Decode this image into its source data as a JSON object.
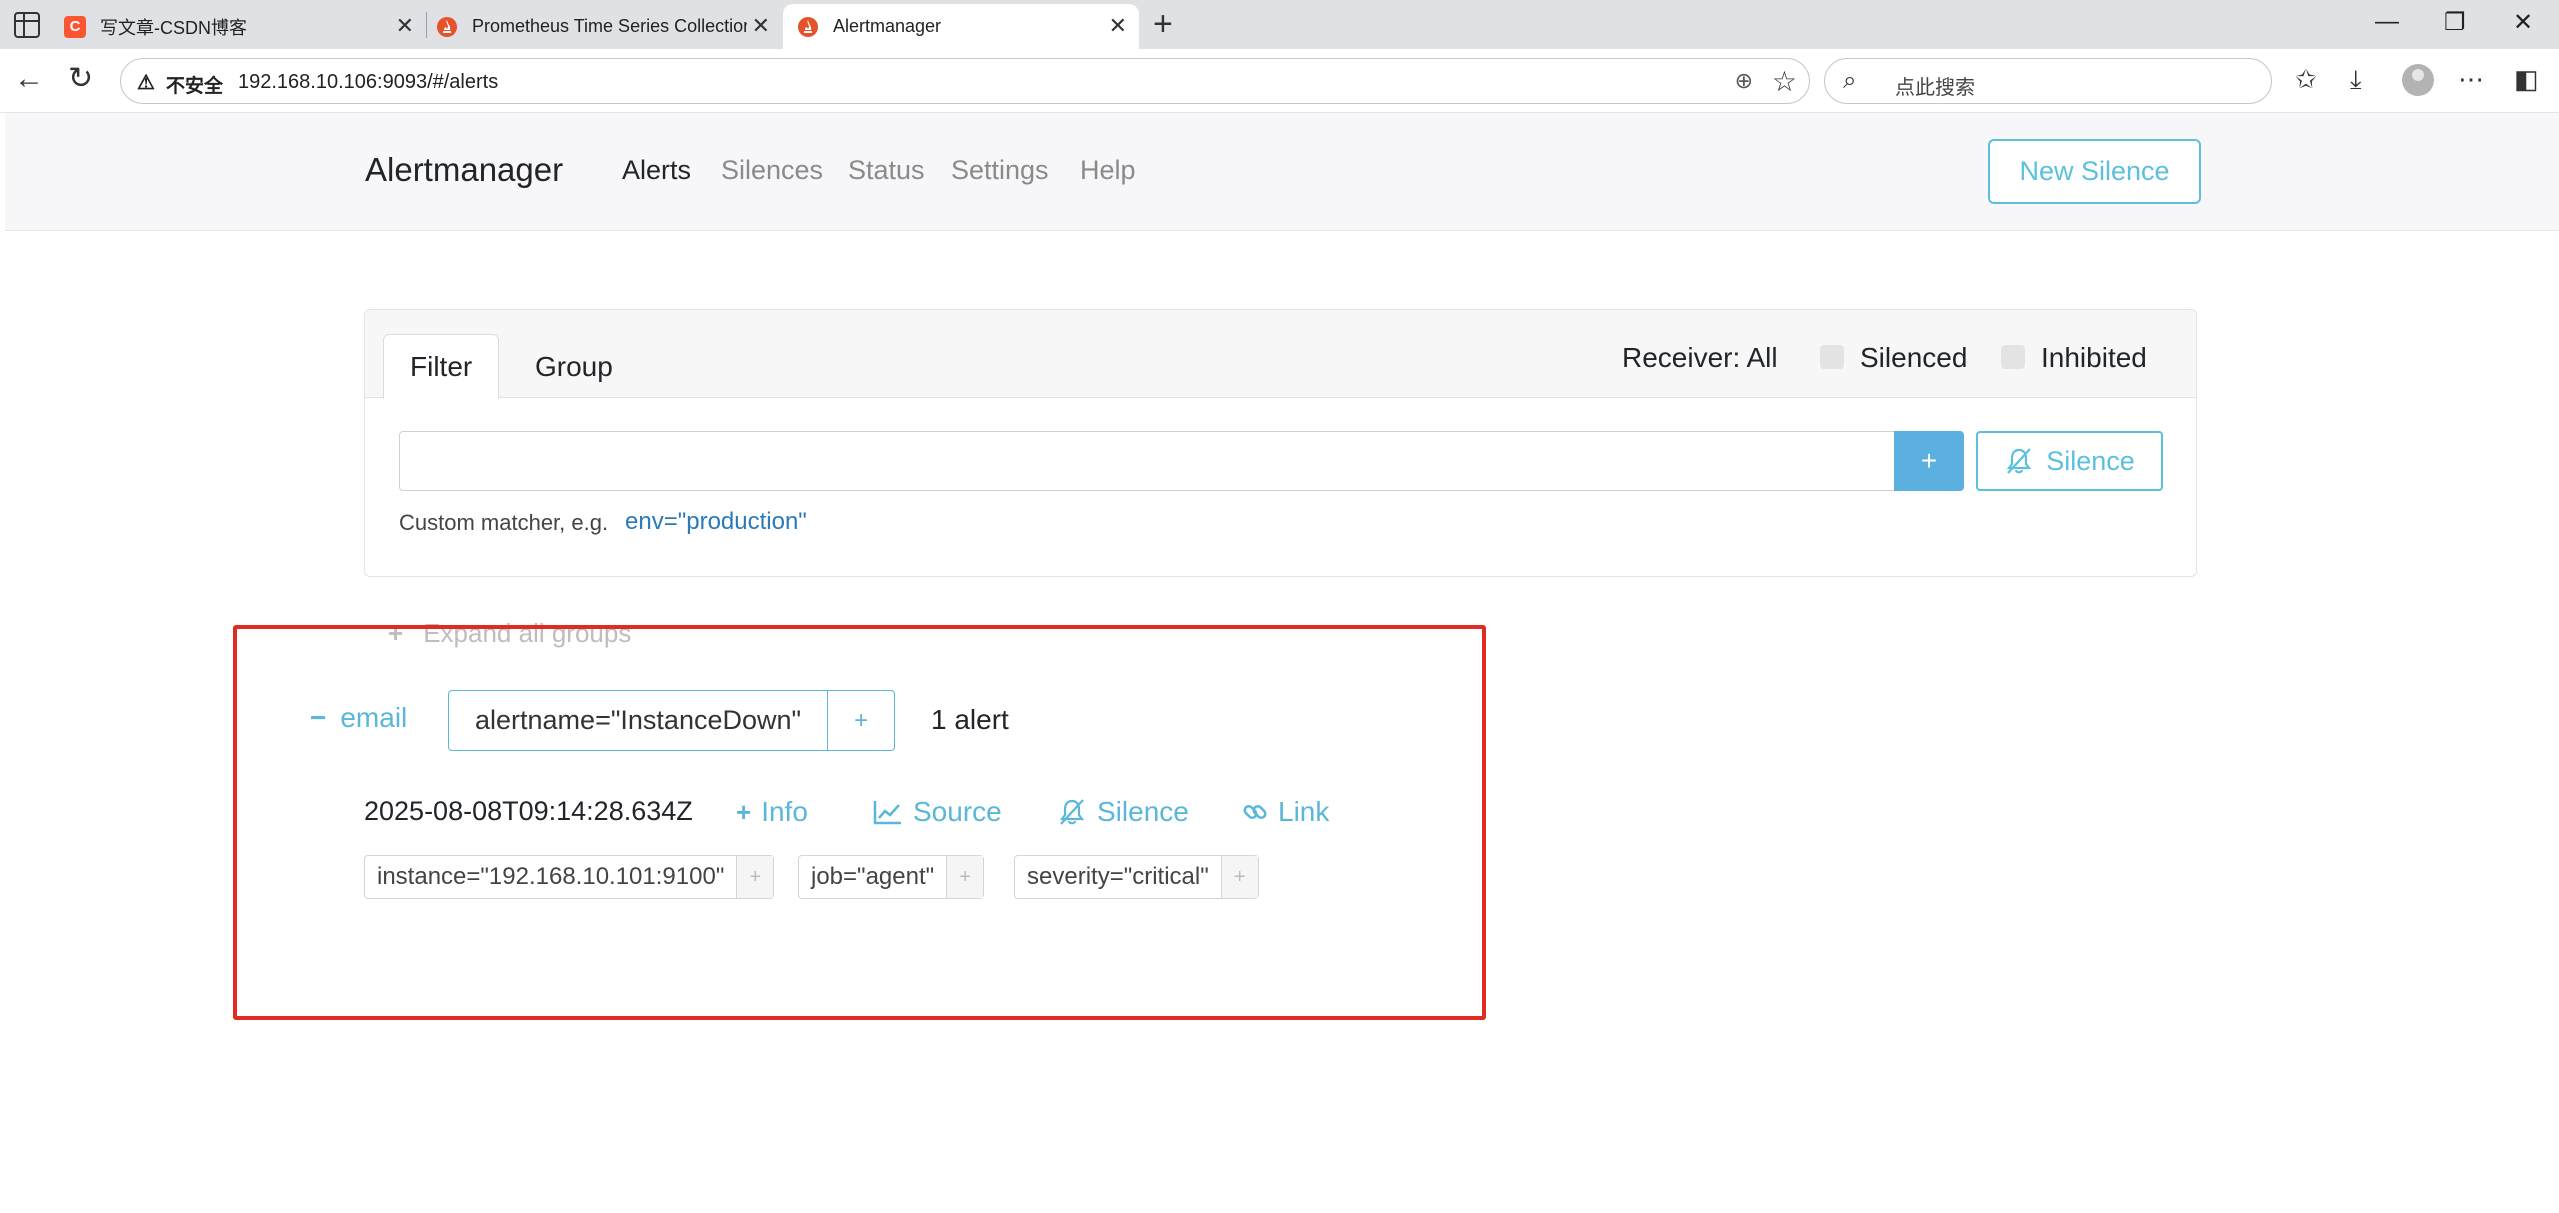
{
  "browser": {
    "tabs": [
      {
        "title": "写文章-CSDN博客",
        "favicon": "csdn-logo",
        "active": false
      },
      {
        "title": "Prometheus Time Series Collection and Processing Server",
        "favicon": "prometheus-logo",
        "active": false
      },
      {
        "title": "Alertmanager",
        "favicon": "prometheus-logo",
        "active": true
      }
    ],
    "security_label": "不安全",
    "url": "192.168.10.106:9093/#/alerts",
    "search_placeholder": "点此搜索"
  },
  "navbar": {
    "brand": "Alertmanager",
    "items": [
      {
        "label": "Alerts",
        "active": true
      },
      {
        "label": "Silences",
        "active": false
      },
      {
        "label": "Status",
        "active": false
      },
      {
        "label": "Settings",
        "active": false
      },
      {
        "label": "Help",
        "active": false
      }
    ],
    "new_silence": "New Silence"
  },
  "filter_card": {
    "tabs": [
      "Filter",
      "Group"
    ],
    "receiver": "Receiver: All",
    "silenced_label": "Silenced",
    "inhibited_label": "Inhibited",
    "input_value": "",
    "add_label": "+",
    "silence_label": "Silence",
    "hint": "Custom matcher, e.g.",
    "hint_example": "env=\"production\""
  },
  "expand_all": "Expand all groups",
  "group": {
    "receiver": "email",
    "matcher": "alertname=\"InstanceDown\"",
    "add_label": "+",
    "count": "1 alert",
    "alert": {
      "timestamp": "2025-08-08T09:14:28.634Z",
      "actions": {
        "info": "Info",
        "source": "Source",
        "silence": "Silence",
        "link": "Link"
      },
      "labels": [
        {
          "text": "instance=\"192.168.10.101:9100\"",
          "add": "+"
        },
        {
          "text": "job=\"agent\"",
          "add": "+"
        },
        {
          "text": "severity=\"critical\"",
          "add": "+"
        }
      ]
    }
  },
  "colors": {
    "accent": "#5bc0de",
    "primary_btn": "#5bb0e0",
    "highlight_box": "#e02a22",
    "csdn": "#fc5531"
  }
}
